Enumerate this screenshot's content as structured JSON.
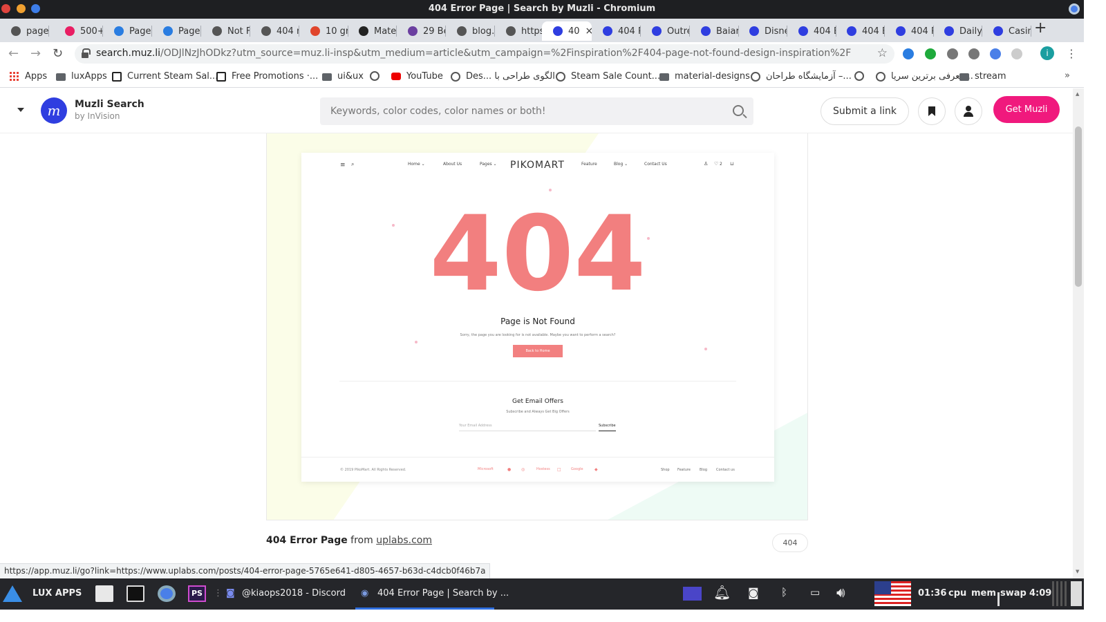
{
  "window": {
    "title": "404 Error Page | Search by Muzli - Chromium"
  },
  "tabs": [
    {
      "label": "page-",
      "favicon": "globe-icon",
      "color": "#555555"
    },
    {
      "label": "500+",
      "favicon": "muzli-pink-icon",
      "color": "#e91e63"
    },
    {
      "label": "Page",
      "favicon": "owl-icon",
      "color": "#2a7de1"
    },
    {
      "label": "Page",
      "favicon": "owl-icon",
      "color": "#2a7de1"
    },
    {
      "label": "Not F",
      "favicon": "globe-icon",
      "color": "#555555"
    },
    {
      "label": "404 n",
      "favicon": "globe-icon",
      "color": "#555555"
    },
    {
      "label": "10 gr",
      "favicon": "ux-icon",
      "color": "#e0452c"
    },
    {
      "label": "Mate",
      "favicon": "codepen-icon",
      "color": "#222222"
    },
    {
      "label": "29 Be",
      "favicon": "colorlib-icon",
      "color": "#6b3fa0"
    },
    {
      "label": "blog.f",
      "favicon": "globe-icon",
      "color": "#555555"
    },
    {
      "label": "https:",
      "favicon": "globe-icon",
      "color": "#555555"
    },
    {
      "label": "40",
      "favicon": "muzli-icon",
      "color": "#2f3ee0",
      "active": true
    },
    {
      "label": "404 P",
      "favicon": "muzli-icon",
      "color": "#2f3ee0"
    },
    {
      "label": "Outre",
      "favicon": "muzli-icon",
      "color": "#2f3ee0"
    },
    {
      "label": "Baiar",
      "favicon": "muzli-icon",
      "color": "#2f3ee0"
    },
    {
      "label": "Disne",
      "favicon": "muzli-icon",
      "color": "#2f3ee0"
    },
    {
      "label": "404 E",
      "favicon": "muzli-icon",
      "color": "#2f3ee0"
    },
    {
      "label": "404 E",
      "favicon": "muzli-icon",
      "color": "#2f3ee0"
    },
    {
      "label": "404 P",
      "favicon": "muzli-icon",
      "color": "#2f3ee0"
    },
    {
      "label": "Daily",
      "favicon": "muzli-icon",
      "color": "#2f3ee0"
    },
    {
      "label": "Casin",
      "favicon": "muzli-icon",
      "color": "#2f3ee0"
    }
  ],
  "address": {
    "host": "search.muz.li",
    "path": "/ODJlNzJhODkz?utm_source=muz.li-insp&utm_medium=article&utm_campaign=%2Finspiration%2F404-page-not-found-design-inspiration%2F"
  },
  "extension_colors": [
    "#2a7de1",
    "#1eaa3c",
    "#777777",
    "#777777",
    "#4a7fe8",
    "#cccccc",
    "#1a9ea0"
  ],
  "profile_initial": "i",
  "bookmarks": [
    {
      "label": "Apps",
      "icon": "apps-grid-icon"
    },
    {
      "label": "luxApps",
      "icon": "folder-icon"
    },
    {
      "label": "Current Steam Sal...",
      "icon": "steam-icon"
    },
    {
      "label": "Free Promotions ·...",
      "icon": "steam-icon"
    },
    {
      "label": "ui&ux",
      "icon": "folder-icon"
    },
    {
      "label": "",
      "icon": "globe-icon"
    },
    {
      "label": "YouTube",
      "icon": "youtube-icon"
    },
    {
      "label": "Des... الگوی طراحی با",
      "icon": "globe-icon"
    },
    {
      "label": "Steam Sale Count...",
      "icon": "globe-icon"
    },
    {
      "label": "material-designs",
      "icon": "folder-icon"
    },
    {
      "label": "آزمایشگاه طراحان –...",
      "icon": "globe-icon"
    },
    {
      "label": "",
      "icon": "globe-icon"
    },
    {
      "label": "معرفی برترین سریا...",
      "icon": "globe-icon"
    },
    {
      "label": "stream",
      "icon": "folder-icon"
    }
  ],
  "muzli": {
    "brand": "Muzli Search",
    "sub": "by InVision",
    "logo_letter": "m",
    "search_placeholder": "Keywords, color codes, color names or both!",
    "submit_label": "Submit a link",
    "get_label": "Get Muzli",
    "accent": "#f0197d"
  },
  "preview": {
    "nav_items": [
      "Home ⌄",
      "About Us",
      "Pages ⌄",
      "Feature",
      "Blog ⌄",
      "Contact Us"
    ],
    "logo": "PIKOMART",
    "wishlist_count": "2",
    "error_code": "404",
    "title": "Page is Not Found",
    "subtitle": "Sorry, the page you are looking for is not available. Maybe you want to perform a search?",
    "button": "Back to Home",
    "email_title": "Get Email Offers",
    "email_sub": "Subscribe and Always Get Big Offers",
    "email_placeholder": "Your Email Address",
    "subscribe": "Subscribe",
    "copyright": "© 2019 PikoMart. All Rights Reserved.",
    "brands": [
      "Microsoft",
      "",
      "",
      "Hostess",
      "",
      "Google",
      ""
    ],
    "footer_links": [
      "Shop",
      "Feature",
      "Blog",
      "Contact us"
    ]
  },
  "caption": {
    "title": "404 Error Page",
    "from": "from",
    "source": "uplabs.com",
    "tag": "404"
  },
  "status_url": "https://app.muz.li/go?link=https://www.uplabs.com/posts/404-error-page-5765e641-d805-4657-b63d-c4dcb0f46b7a",
  "taskbar": {
    "launcher": "LUX APPS",
    "windows": [
      "@kiaops2018 - Discord",
      "404 Error Page | Search by ..."
    ],
    "time1": "01:36",
    "cpu": "cpu",
    "mem": "mem",
    "swap": "swap",
    "time2": "4:09"
  }
}
